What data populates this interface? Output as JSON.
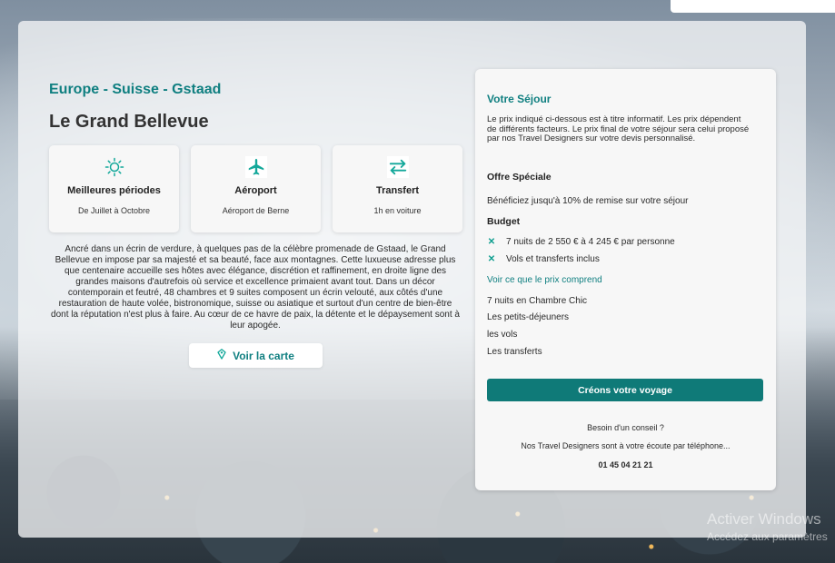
{
  "destination": {
    "breadcrumb": "Europe - Suisse - Gstaad",
    "hotel_name": "Le Grand Bellevue"
  },
  "info_cards": [
    {
      "icon": "sun-icon",
      "title": "Meilleures périodes",
      "subtitle": "De Juillet à Octobre"
    },
    {
      "icon": "airplane-icon",
      "title": "Aéroport",
      "subtitle": "Aéroport de Berne"
    },
    {
      "icon": "transfer-arrows-icon",
      "title": "Transfert",
      "subtitle": "1h en voiture"
    }
  ],
  "description": "Ancré dans un écrin de verdure, à quelques pas de la célèbre promenade de Gstaad, le Grand Bellevue en impose par sa majesté et sa beauté, face aux montagnes. Cette luxueuse adresse plus que centenaire accueille ses hôtes avec élégance, discrétion et raffinement, en droite ligne des grandes maisons d'autrefois où service et excellence primaient avant tout. Dans un décor contemporain et feutré, 48 chambres et 9 suites composent un écrin velouté, aux côtés d'une restauration de haute volée, bistronomique, suisse ou asiatique et surtout d'un centre de bien-être dont la réputation n'est plus à faire. Au cœur de ce havre de paix, la détente et le dépaysement sont à leur apogée.",
  "map_button": {
    "label": "Voir la carte",
    "icon": "map-pin-icon"
  },
  "sejour": {
    "title": "Votre Séjour",
    "disclaimer": "Le prix indiqué ci-dessous est à titre informatif. Les prix dépendent de différents facteurs. Le prix final de votre séjour sera celui proposé par nos Travel Designers sur votre devis personnalisé.",
    "offer_heading": "Offre Spéciale",
    "offer_text": "Bénéficiez jusqu'à 10% de remise sur votre séjour",
    "budget_heading": "Budget",
    "budget_items": [
      "7 nuits de 2 550 € à 4 245 € par personne",
      "Vols et transferts inclus"
    ],
    "includes_link": "Voir ce que le prix comprend",
    "includes": [
      "7 nuits en Chambre Chic",
      "Les petits-déjeuners",
      "les vols",
      "Les transferts"
    ],
    "cta_label": "Créons votre voyage",
    "help_title": "Besoin d'un conseil ?",
    "help_text": "Nos Travel Designers sont à votre écoute par téléphone...",
    "phone": "01 45 04 21 21"
  },
  "watermark": {
    "line1": "Activer Windows",
    "line2": "Accédez aux paramètres"
  },
  "colors": {
    "accent": "#0f7f80",
    "cta": "#0f7a78",
    "bullet": "#0f9e8f"
  }
}
